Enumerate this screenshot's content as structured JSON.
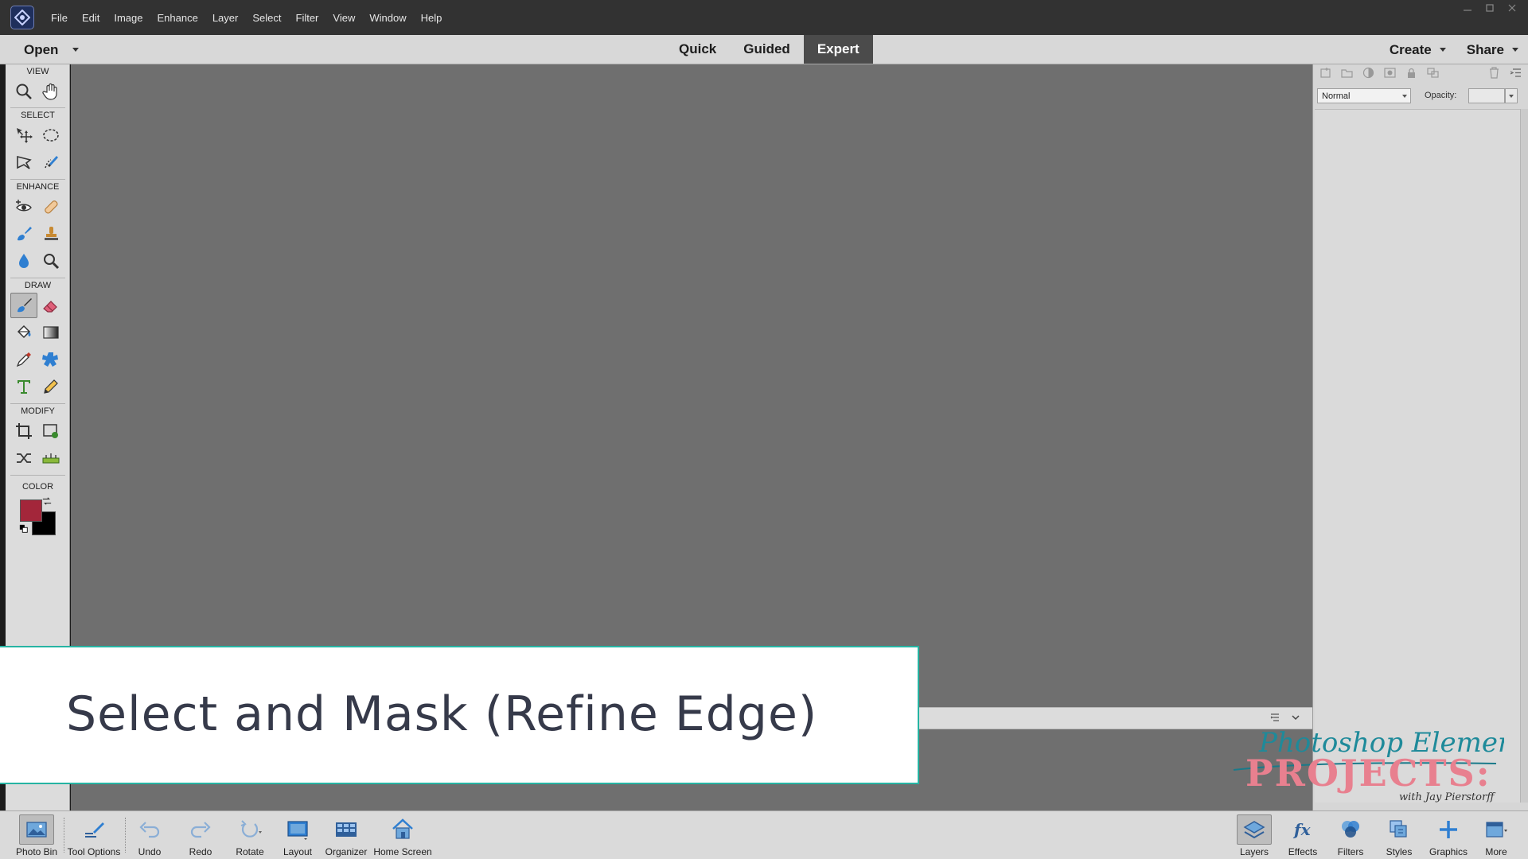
{
  "menubar": {
    "items": [
      "File",
      "Edit",
      "Image",
      "Enhance",
      "Layer",
      "Select",
      "Filter",
      "View",
      "Window",
      "Help"
    ],
    "window_controls": [
      "minimize-icon",
      "restore-icon",
      "close-icon"
    ]
  },
  "modebar": {
    "open_label": "Open",
    "tabs": [
      {
        "label": "Quick",
        "active": false
      },
      {
        "label": "Guided",
        "active": false
      },
      {
        "label": "Expert",
        "active": true
      }
    ],
    "create_label": "Create",
    "share_label": "Share"
  },
  "toolbox": {
    "sections": {
      "view": "VIEW",
      "select": "SELECT",
      "enhance": "ENHANCE",
      "draw": "DRAW",
      "modify": "MODIFY",
      "color": "COLOR"
    },
    "tools": {
      "view": [
        "zoom-icon",
        "hand-icon"
      ],
      "select": [
        "move-icon",
        "elliptical-marquee-icon",
        "polygonal-lasso-icon",
        "quick-selection-icon"
      ],
      "enhance": [
        "red-eye-icon",
        "spot-healing-icon",
        "smart-brush-icon",
        "clone-stamp-icon",
        "blur-icon",
        "sponge-icon"
      ],
      "draw": [
        "brush-icon",
        "eraser-icon",
        "paint-bucket-icon",
        "gradient-icon",
        "color-picker-icon",
        "custom-shape-icon",
        "type-icon",
        "pencil-icon"
      ],
      "modify": [
        "crop-icon",
        "recompose-icon",
        "content-aware-move-icon",
        "straighten-icon"
      ]
    },
    "active_tool": "brush-icon",
    "foreground_color": "#a3263a",
    "background_color": "#000000"
  },
  "layers_panel": {
    "blend_mode": "Normal",
    "opacity_label": "Opacity:",
    "opacity_value": ""
  },
  "taskbar": {
    "left": [
      {
        "label": "Photo Bin",
        "icon": "photo-bin-icon",
        "active": true
      },
      {
        "label": "Tool Options",
        "icon": "tool-options-icon",
        "active": false
      },
      {
        "label": "Undo",
        "icon": "undo-icon",
        "active": false
      },
      {
        "label": "Redo",
        "icon": "redo-icon",
        "active": false
      },
      {
        "label": "Rotate",
        "icon": "rotate-icon",
        "active": false
      },
      {
        "label": "Layout",
        "icon": "layout-icon",
        "active": false
      },
      {
        "label": "Organizer",
        "icon": "organizer-icon",
        "active": false
      },
      {
        "label": "Home Screen",
        "icon": "home-icon",
        "active": false
      }
    ],
    "right": [
      {
        "label": "Layers",
        "icon": "layers-icon",
        "active": true
      },
      {
        "label": "Effects",
        "icon": "effects-icon",
        "active": false
      },
      {
        "label": "Filters",
        "icon": "filters-icon",
        "active": false
      },
      {
        "label": "Styles",
        "icon": "styles-icon",
        "active": false
      },
      {
        "label": "Graphics",
        "icon": "graphics-icon",
        "active": false
      },
      {
        "label": "More",
        "icon": "more-icon",
        "active": false
      }
    ]
  },
  "overlay": {
    "title": "Select and Mask (Refine Edge)",
    "accent_color": "#26b4a3"
  },
  "watermark": {
    "script_line": "Photoshop Elements",
    "main_line": "PROJECTS:",
    "byline": "with Jay Pierstorff"
  },
  "colors": {
    "canvas": "#6f6f6f",
    "menubar": "#323232",
    "active_tab": "#4b4b4b"
  }
}
